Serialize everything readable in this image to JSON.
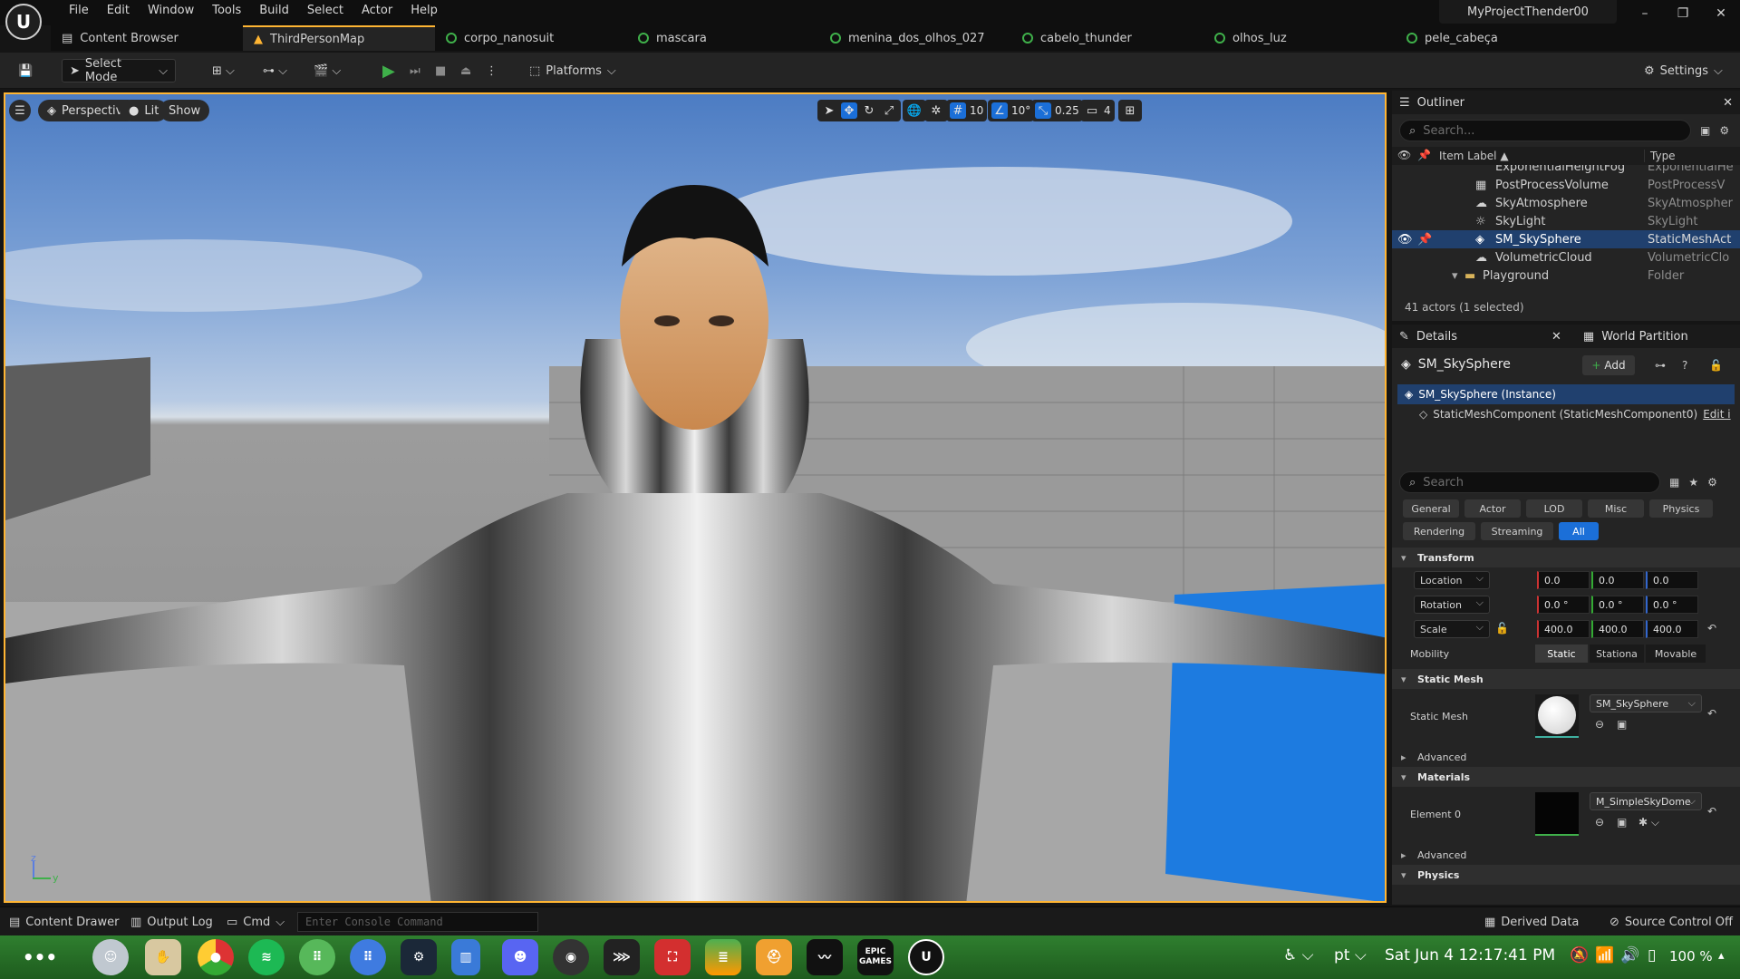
{
  "menu": [
    "File",
    "Edit",
    "Window",
    "Tools",
    "Build",
    "Select",
    "Actor",
    "Help"
  ],
  "project_name": "MyProjectThender00",
  "tabs": [
    {
      "label": "Content Browser",
      "icon": "content-browser-icon",
      "type": "panel"
    },
    {
      "label": "ThirdPersonMap",
      "icon": "level-icon",
      "type": "active"
    },
    {
      "label": "corpo_nanosuit",
      "icon": "material-icon"
    },
    {
      "label": "mascara",
      "icon": "material-icon"
    },
    {
      "label": "menina_dos_olhos_027",
      "icon": "material-icon"
    },
    {
      "label": "cabelo_thunder",
      "icon": "material-icon"
    },
    {
      "label": "olhos_luz",
      "icon": "material-icon"
    },
    {
      "label": "pele_cabeça",
      "icon": "material-icon"
    }
  ],
  "toolbar": {
    "select_mode": "Select Mode",
    "platforms": "Platforms",
    "settings": "Settings"
  },
  "viewport": {
    "perspective": "Perspective",
    "lit": "Lit",
    "show": "Show",
    "grid_snap": "10",
    "rotation_snap": "10°",
    "scale_snap": "0.25",
    "camera_speed": "4",
    "axis_z": "z",
    "axis_y": "y"
  },
  "outliner": {
    "title": "Outliner",
    "search_placeholder": "Search...",
    "col_label": "Item Label ▲",
    "col_type": "Type",
    "rows": [
      {
        "label": "ExponentialHeightFog",
        "type": "ExponentialHe",
        "selected": false,
        "partial": true
      },
      {
        "label": "PostProcessVolume",
        "type": "PostProcessV",
        "selected": false
      },
      {
        "label": "SkyAtmosphere",
        "type": "SkyAtmospher",
        "selected": false
      },
      {
        "label": "SkyLight",
        "type": "SkyLight",
        "selected": false
      },
      {
        "label": "SM_SkySphere",
        "type": "StaticMeshAct",
        "selected": true
      },
      {
        "label": "VolumetricCloud",
        "type": "VolumetricClo",
        "selected": false
      },
      {
        "label": "Playground",
        "type": "Folder",
        "selected": false,
        "folder": true
      }
    ],
    "status": "41 actors (1 selected)"
  },
  "details": {
    "title": "Details",
    "world_partition": "World Partition",
    "actor_name": "SM_SkySphere",
    "add_label": "Add",
    "instance_label": "SM_SkySphere (Instance)",
    "component_label": "StaticMeshComponent (StaticMeshComponent0)",
    "edit_link": "Edit i",
    "search_placeholder": "Search",
    "categories": [
      "General",
      "Actor",
      "LOD",
      "Misc",
      "Physics",
      "Rendering",
      "Streaming",
      "All"
    ],
    "transform_title": "Transform",
    "location_label": "Location",
    "rotation_label": "Rotation",
    "scale_label": "Scale",
    "location": [
      "0.0",
      "0.0",
      "0.0"
    ],
    "rotation": [
      "0.0 °",
      "0.0 °",
      "0.0 °"
    ],
    "scale": [
      "400.0",
      "400.0",
      "400.0"
    ],
    "mobility_label": "Mobility",
    "mobility_options": [
      "Static",
      "Stationa",
      "Movable"
    ],
    "mobility_selected": "Static",
    "static_mesh_title": "Static Mesh",
    "static_mesh_label": "Static Mesh",
    "static_mesh_value": "SM_SkySphere",
    "advanced": "Advanced",
    "materials_title": "Materials",
    "element0_label": "Element 0",
    "element0_value": "M_SimpleSkyDome",
    "physics_title": "Physics"
  },
  "statusbar": {
    "content_drawer": "Content Drawer",
    "output_log": "Output Log",
    "cmd": "Cmd",
    "console_placeholder": "Enter Console Command",
    "derived_data": "Derived Data",
    "source_control": "Source Control Off"
  },
  "taskbar": {
    "apps": [
      "app-grid",
      "finder-like",
      "hand-app",
      "chrome",
      "spotify",
      "calculator",
      "launcher",
      "steam",
      "files",
      "discord",
      "obs",
      "shortcut",
      "toolbox",
      "stack",
      "hat",
      "activity",
      "epic-games",
      "unreal"
    ],
    "epic_label": "EPIC GAMES",
    "lang": "pt",
    "clock": "Sat Jun 4  12:17:41 PM",
    "battery": "100 %"
  },
  "colors": {
    "accent": "#ffb533",
    "selection": "#20406e",
    "blue": "#1b6fd8",
    "play": "#3fb04a"
  }
}
